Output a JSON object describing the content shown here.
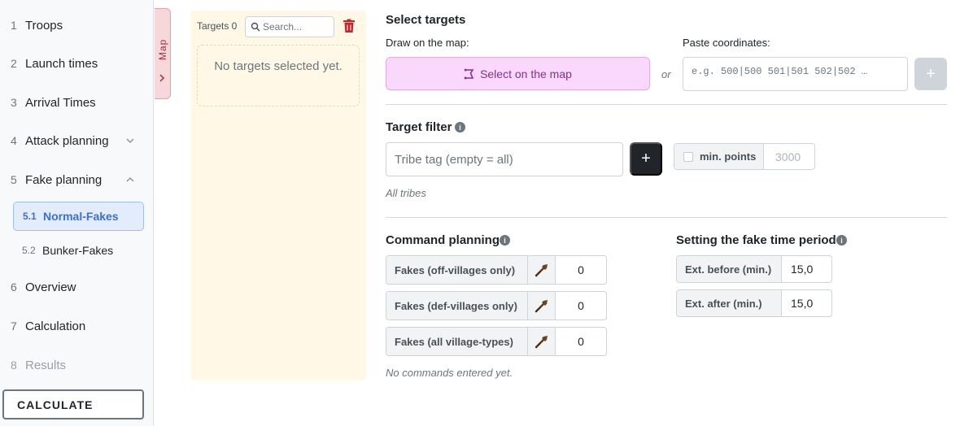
{
  "sidebar": {
    "items": [
      {
        "num": "1",
        "label": "Troops"
      },
      {
        "num": "2",
        "label": "Launch times"
      },
      {
        "num": "3",
        "label": "Arrival Times"
      },
      {
        "num": "4",
        "label": "Attack planning"
      },
      {
        "num": "5",
        "label": "Fake planning"
      },
      {
        "num": "6",
        "label": "Overview"
      },
      {
        "num": "7",
        "label": "Calculation"
      },
      {
        "num": "8",
        "label": "Results"
      }
    ],
    "sub_items": [
      {
        "num": "5.1",
        "label": "Normal-Fakes",
        "active": true
      },
      {
        "num": "5.2",
        "label": "Bunker-Fakes",
        "active": false
      }
    ],
    "calculate_label": "CALCULATE"
  },
  "map_tab": {
    "label": "Map"
  },
  "targets": {
    "count_label": "Targets 0",
    "search_placeholder": "Search...",
    "empty_text": "No targets selected yet."
  },
  "select_targets": {
    "title": "Select targets",
    "draw_label": "Draw on the map:",
    "select_map_label": "Select on the map",
    "or_label": "or",
    "paste_label": "Paste coordinates:",
    "coords_placeholder": "e.g. 500|500 501|501 502|502 …",
    "add_label": "+"
  },
  "target_filter": {
    "title": "Target filter",
    "tribe_placeholder": "Tribe tag (empty = all)",
    "add_label": "+",
    "min_points_label": "min. points",
    "min_points_value": "3000",
    "hint": "All tribes"
  },
  "command_planning": {
    "title": "Command planning",
    "rows": [
      {
        "label": "Fakes (off-villages only)",
        "value": "0"
      },
      {
        "label": "Fakes (def-villages only)",
        "value": "0"
      },
      {
        "label": "Fakes (all village-types)",
        "value": "0"
      }
    ],
    "hint": "No commands entered yet."
  },
  "fake_time": {
    "title": "Setting the fake time period",
    "rows": [
      {
        "label": "Ext. before (min.)",
        "value": "15,0"
      },
      {
        "label": "Ext. after (min.)",
        "value": "15,0"
      }
    ]
  },
  "colors": {
    "accent": "#3a6fd8",
    "map_button": "#f9d8fb",
    "targets_bg": "#fff8e6",
    "trash": "#c0262d"
  }
}
